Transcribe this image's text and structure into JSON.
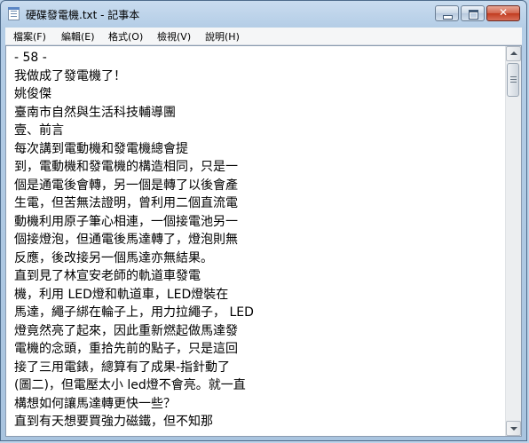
{
  "window": {
    "title": "硬碟發電機.txt - 記事本",
    "close_symbol": "✕"
  },
  "menu": {
    "file": "檔案(F)",
    "edit": "編輯(E)",
    "format": "格式(O)",
    "view": "檢視(V)",
    "help": "說明(H)"
  },
  "document": {
    "lines": [
      "- 58 -",
      "我做成了發電機了！",
      "姚俊傑",
      "臺南市自然與生活科技輔導團",
      "壹、前言",
      "每次講到電動機和發電機總會提",
      "到，電動機和發電機的構造相同，只是一",
      "個是通電後會轉，另一個是轉了以後會產",
      "生電，但苦無法證明，曾利用二個直流電",
      "動機利用原子筆心相連，一個接電池另一",
      "個接燈泡，但通電後馬達轉了，燈泡則無",
      "反應，後改接另一個馬達亦無結果。",
      "直到見了林宣安老師的軌道車發電",
      "機，利用 LED燈和軌道車，LED燈裝在",
      "馬達，繩子綁在輪子上，用力拉繩子， LED",
      "燈竟然亮了起來，因此重新燃起做馬達發",
      "電機的念頭，重拾先前的點子，只是這回",
      "接了三用電錶，總算有了成果-指針動了",
      "(圖二)，但電壓太小 led燈不會亮。就一直",
      "構想如何讓馬達轉更快一些？",
      "直到有天想要買強力磁鐵，但不知那"
    ]
  }
}
